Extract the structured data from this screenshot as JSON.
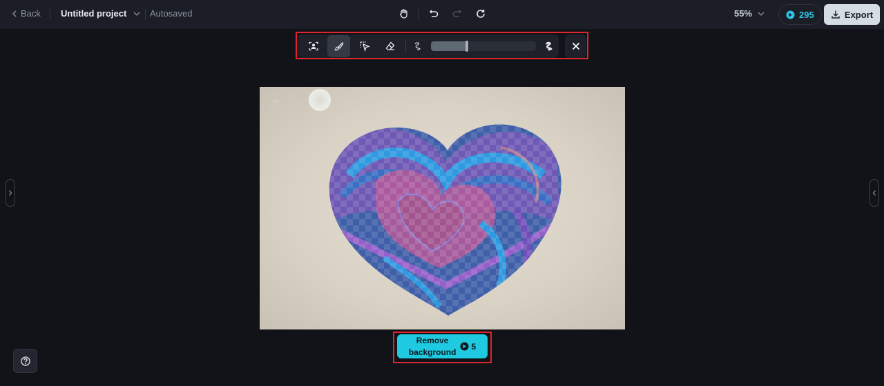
{
  "topbar": {
    "back_label": "Back",
    "project_title": "Untitled project",
    "status": "Autosaved",
    "zoom_level": "55%",
    "credits": "295",
    "export_label": "Export"
  },
  "toolbar": {
    "tools": [
      {
        "name": "auto-select-subject",
        "icon": "person-frame-icon",
        "active": false
      },
      {
        "name": "brush",
        "icon": "brush-icon",
        "active": true
      },
      {
        "name": "smart-select",
        "icon": "dashed-cursor-icon",
        "active": false
      },
      {
        "name": "eraser",
        "icon": "eraser-icon",
        "active": false
      }
    ],
    "brush_size_percent": 34
  },
  "canvas": {
    "ai_badge": "AI"
  },
  "action": {
    "remove_label_line1": "Remove",
    "remove_label_line2": "background",
    "cost": "5"
  },
  "colors": {
    "accent": "#1fc9e0",
    "credits": "#2ec4e6",
    "highlight": "#e0252d"
  }
}
